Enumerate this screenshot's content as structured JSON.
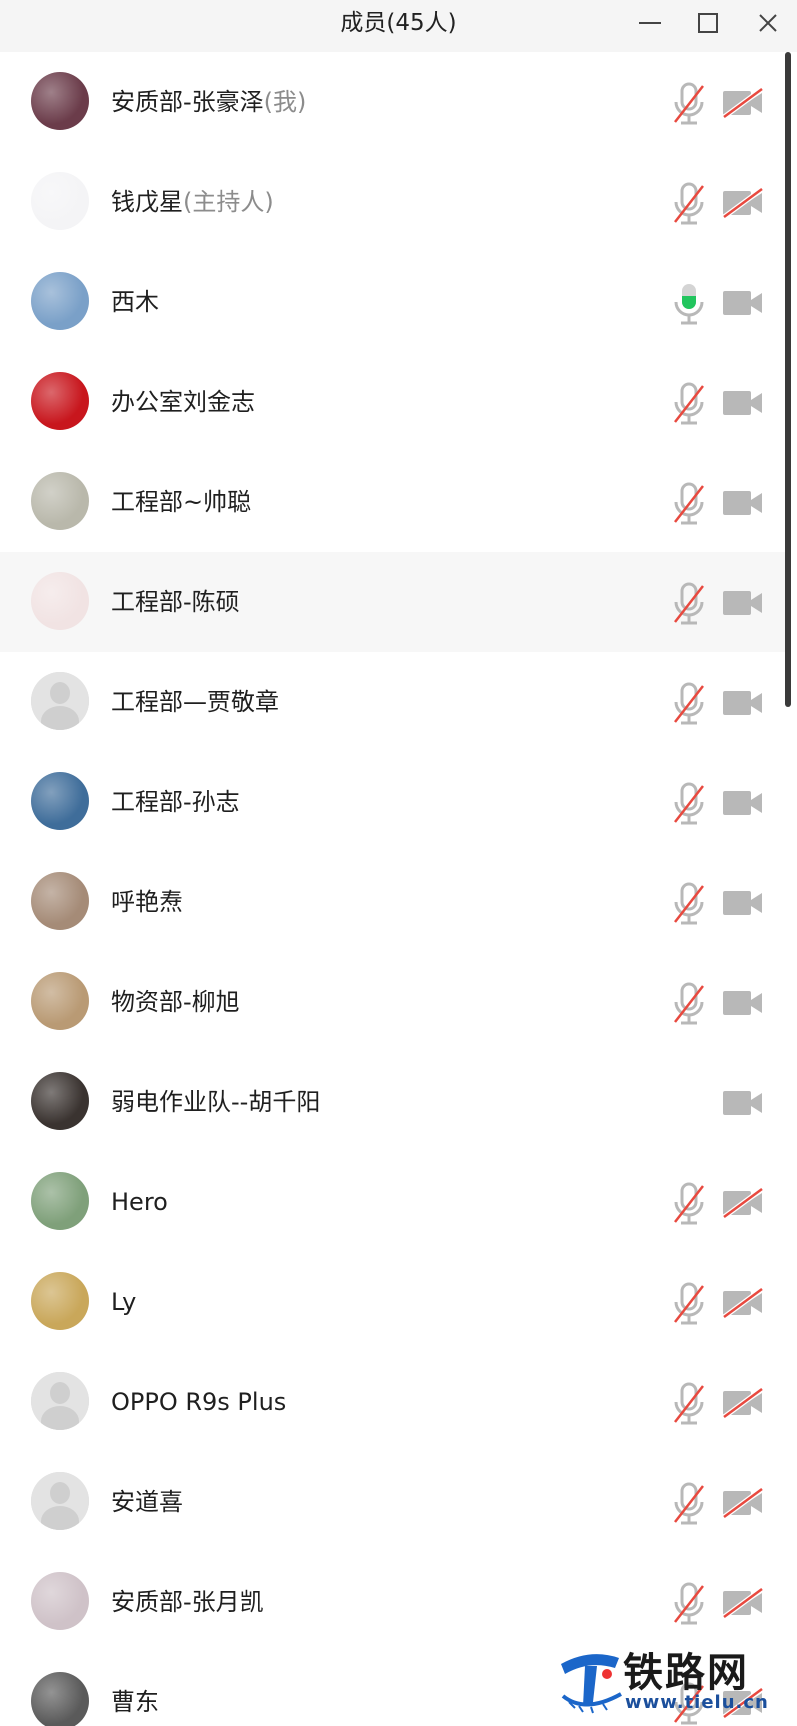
{
  "window": {
    "title": "成员(45人)"
  },
  "members": [
    {
      "name": "安质部-张豪泽",
      "role": "(我)",
      "mic": "muted",
      "cam": "off",
      "avatar": "photo-man-selfie",
      "color": "#6b3c4a"
    },
    {
      "name": "钱戊星",
      "role": "(主持人)",
      "mic": "muted",
      "cam": "off",
      "avatar": "logo-circle-emblem",
      "color": "#f4f4f6"
    },
    {
      "name": "西木",
      "role": "",
      "mic": "speaking",
      "cam": "available",
      "avatar": "photo-lighthouse-sea",
      "color": "#7aa0c8"
    },
    {
      "name": "办公室刘金志",
      "role": "",
      "mic": "muted",
      "cam": "available",
      "avatar": "red-emblem-china-jiayou",
      "color": "#c8161d"
    },
    {
      "name": "工程部~帅聪",
      "role": "",
      "mic": "muted",
      "cam": "available",
      "avatar": "signature-handwriting",
      "color": "#b9b8ab"
    },
    {
      "name": "工程部-陈硕",
      "role": "",
      "mic": "muted",
      "cam": "available",
      "avatar": "handwritten-love-you",
      "color": "#f1e3e3",
      "hovered": true
    },
    {
      "name": "工程部—贾敬章",
      "role": "",
      "mic": "muted",
      "cam": "available",
      "avatar": "default-placeholder",
      "color": "#e3e3e3"
    },
    {
      "name": "工程部-孙志",
      "role": "",
      "mic": "muted",
      "cam": "available",
      "avatar": "photo-man-striped-shirt",
      "color": "#3f6d9a"
    },
    {
      "name": "呼艳焘",
      "role": "",
      "mic": "muted",
      "cam": "available",
      "avatar": "photo-woman-indoor",
      "color": "#a58b77"
    },
    {
      "name": "物资部-柳旭",
      "role": "",
      "mic": "muted",
      "cam": "available",
      "avatar": "photo-dog-mask",
      "color": "#b99a74"
    },
    {
      "name": "弱电作业队--胡千阳",
      "role": "",
      "mic": "none",
      "cam": "available",
      "avatar": "photo-dark-person",
      "color": "#3a3330"
    },
    {
      "name": "Hero",
      "role": "",
      "mic": "muted",
      "cam": "off",
      "avatar": "photo-woman-flowers",
      "color": "#7fa07a"
    },
    {
      "name": "Ly",
      "role": "",
      "mic": "muted",
      "cam": "off",
      "avatar": "photo-landscape-trees",
      "color": "#c9a75a"
    },
    {
      "name": "OPPO R9s Plus",
      "role": "",
      "mic": "muted",
      "cam": "off",
      "avatar": "default-placeholder",
      "color": "#e3e3e3"
    },
    {
      "name": "安道喜",
      "role": "",
      "mic": "muted",
      "cam": "off",
      "avatar": "default-placeholder",
      "color": "#e3e3e3"
    },
    {
      "name": "安质部-张月凯",
      "role": "",
      "mic": "muted",
      "cam": "off",
      "avatar": "photo-person-light",
      "color": "#cfc2c8"
    },
    {
      "name": "曹东",
      "role": "",
      "mic": "muted",
      "cam": "off",
      "avatar": "photo-man-standing",
      "color": "#5a5a5a"
    }
  ],
  "watermark": {
    "brand": "铁路网",
    "url": "www.tielu.cn"
  },
  "colors": {
    "icon_gray": "#b8b8b8",
    "mute_red": "#e8493f",
    "speaking_green": "#22c55e",
    "hover_bg": "#f7f7f7",
    "titlebar_bg": "#f5f5f5"
  }
}
